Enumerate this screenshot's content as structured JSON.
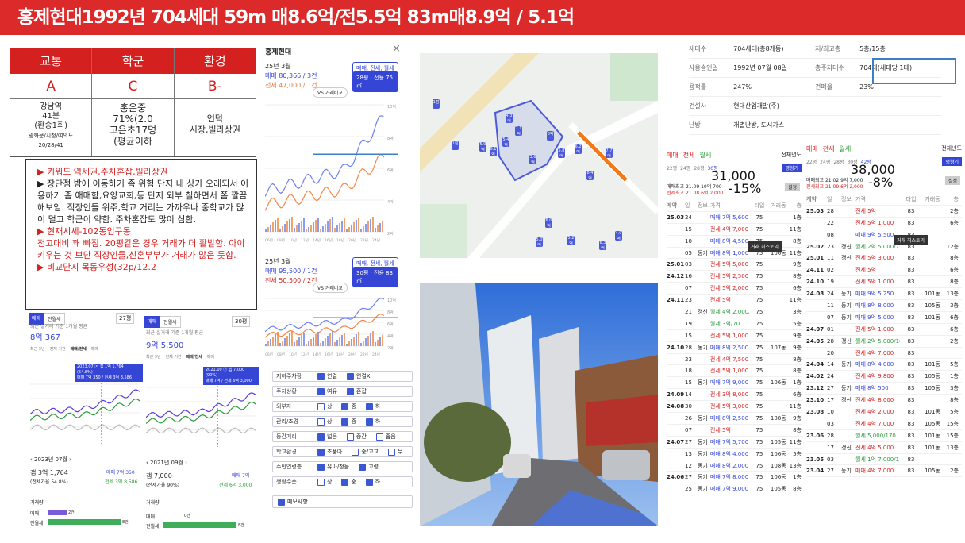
{
  "banner": {
    "title": "홍제현대1992년 704세대 59m 매8.6억/전5.5억 83m매8.9억 / 5.1억"
  },
  "grades": {
    "headers": [
      "교통",
      "학군",
      "환경"
    ],
    "values": [
      "A",
      "C",
      "B-"
    ],
    "details": [
      [
        "강남역",
        "41분",
        "(환승1회)",
        "광화문/시청/여의도",
        "20/28/41"
      ],
      [
        "홍은중",
        "71%(2.0",
        "고은초17명",
        "(평균이하"
      ],
      [
        "언덕",
        "시장,빌라상권"
      ]
    ]
  },
  "notes": {
    "lines": [
      "▶ 키워드 역세권,주차혼잡,빌라상권",
      "▶ 장단점 밤에 이동하기 좀 위험 단지 내 상가 오래되서 이용하기 좀 애매함,요양교회,등 단지 외부 칠하면서 쫌 깔끔해보임. 직장인들 위주,학교 거리는 가까우나 중학교가 많이 멀고 학군이 약함. 주차혼잡도 많이 심함.",
      "▶ 현재시세-102동입구동",
      "전고대비 꽤 빠짐. 20평같은 경우 거래가 더 활발함. 아이키우는 것 보단 직장인들,신혼부부가 거래가 많은 듯함.",
      "▶ 비교단지 목동우성(32p/12.2"
    ]
  },
  "trend_panel": {
    "title": "홍제현대",
    "close": "×",
    "chart1": {
      "month": "25년 3월",
      "sale": "매매 80,366 / 3건",
      "jeonse": "전세 47,000 / 1건",
      "pill1": "매매, 전세, 월세",
      "pill2": "28평 · 전용 75㎡",
      "compare": "VS 거래비교"
    },
    "chart2": {
      "month": "25년 3월",
      "sale": "매매 95,500 / 1건",
      "jeonse": "전세 50,500 / 2건",
      "pill1": "매매, 전세, 월세",
      "pill2": "30평 · 전용 83㎡",
      "compare": "VS 거래비교"
    },
    "xaxis": [
      "06년",
      "08년",
      "10년",
      "12년",
      "14년",
      "16년",
      "18년",
      "20년",
      "22년",
      "24년"
    ],
    "yaxis1": [
      "10억",
      "8억",
      "6억",
      "4억",
      "2억"
    ],
    "yaxis2": [
      "10억",
      "8억",
      "6억",
      "4억",
      "2억"
    ]
  },
  "filter": {
    "rows": [
      {
        "label": "지하주차장",
        "opts": [
          [
            "연결",
            true
          ],
          [
            "연결X",
            true
          ]
        ]
      },
      {
        "label": "주차상황",
        "opts": [
          [
            "여유",
            true
          ],
          [
            "혼잡",
            true
          ]
        ]
      },
      {
        "label": "외부자",
        "opts": [
          [
            "상",
            false
          ],
          [
            "중",
            true
          ],
          [
            "하",
            true
          ]
        ]
      },
      {
        "label": "관리/조경",
        "opts": [
          [
            "상",
            false
          ],
          [
            "중",
            true
          ],
          [
            "하",
            true
          ]
        ]
      },
      {
        "label": "동간거리",
        "opts": [
          [
            "넓음",
            true
          ],
          [
            "중간",
            false
          ],
          [
            "좁음",
            false
          ]
        ]
      },
      {
        "label": "학교환경",
        "opts": [
          [
            "초품아",
            true
          ],
          [
            "중/고교",
            false
          ],
          [
            "무",
            false
          ]
        ]
      },
      {
        "label": "주민연령층",
        "opts": [
          [
            "유아/청음",
            true
          ],
          [
            "고령",
            true
          ]
        ]
      },
      {
        "label": "생활수준",
        "opts": [
          [
            "상",
            false
          ],
          [
            "중",
            true
          ],
          [
            "하",
            true
          ]
        ]
      }
    ],
    "memo": "메모사항"
  },
  "price_left": {
    "tab1": "매매",
    "tab2": "전월세",
    "select": "27평",
    "caption": "최근 실거래 기준 1개월 평균",
    "price": "8억 367",
    "tabs": [
      "최근 3년",
      "전체 기간",
      "매매/전세",
      "매매"
    ],
    "tip1": "2023.07 ⓔ 갭 1억 1,764 (54.8%)",
    "tip2": "매매 7억 350 / 전세 3억 8,586",
    "date": "2023년 07월",
    "gap": "갭 3억 1,764",
    "ratio": "(전세가율 54.8%)",
    "sv": "매매 7억 350",
    "jv": "전세 3억 8,586",
    "vol_title": "거래량",
    "vol1": "매매",
    "vol2": "전월세",
    "vol1n": "2건",
    "vol2n": "8건"
  },
  "price_right": {
    "tab1": "매매",
    "tab2": "전월세",
    "select": "30평",
    "caption": "최근 실거래 기준 1개월 평균",
    "price": "9억 5,500",
    "tabs": [
      "최근 3년",
      "전체 기간",
      "매매/전세",
      "매매"
    ],
    "tip1": "2021.09 ⓔ 갭 7,000 (90%)",
    "tip2": "매매 7억 / 전세 6억 3,000",
    "date": "2021년 09월",
    "gap": "갭 7,000",
    "ratio": "(전세가율 90%)",
    "sv": "매매 7억",
    "jv": "전세 6억 3,000",
    "vol_title": "거래량",
    "vol1": "매매",
    "vol2": "전월세",
    "vol1n": "0건",
    "vol2n": "8건"
  },
  "summary": {
    "rows": [
      [
        "세대수",
        "704세대(총8개동)",
        "저/최고층",
        "5층/15층"
      ],
      [
        "사용승인일",
        "1992년 07월 08일",
        "총주차대수",
        "704대(세대당 1대)"
      ],
      [
        "용적률",
        "247%",
        "건폐율",
        "23%"
      ],
      [
        "건설사",
        "현대산업개발(주)",
        "",
        ""
      ],
      [
        "난방",
        "개별난방, 도시가스",
        "",
        ""
      ]
    ]
  },
  "table_left": {
    "tabs": [
      "매매",
      "전세",
      "월세"
    ],
    "year": "전체년도",
    "cols": [
      "22평",
      "24평",
      "28평",
      "30평"
    ],
    "btn": "평형기",
    "btn2": "설정",
    "overlay1": "31,000",
    "overlay2": "-15%",
    "line1": "매매최고 21.09 10억 700",
    "line2": "전세최고 21.08 6억 2,000",
    "tooltip": "거래 히스토리",
    "head": [
      "계약",
      "일",
      "정보",
      "가격",
      "타입",
      "거래동",
      "층"
    ],
    "rows": [
      [
        "25.03",
        "24",
        "",
        "매매 7억 5,600",
        "75",
        "",
        "1층",
        "b"
      ],
      [
        "",
        "15",
        "",
        "전세 4억 7,000",
        "75",
        "",
        "11층",
        "r"
      ],
      [
        "",
        "10",
        "",
        "매매 8억 4,500",
        "75",
        "",
        "8층",
        "b"
      ],
      [
        "",
        "05",
        "동기",
        "매매 8억 1,000",
        "75",
        "106동",
        "11층",
        "b"
      ],
      [
        "25.01",
        "03",
        "",
        "전세 5억 5,000",
        "75",
        "",
        "9층",
        "r"
      ],
      [
        "24.12",
        "16",
        "",
        "전세 5억 2,500",
        "75",
        "",
        "8층",
        "r"
      ],
      [
        "",
        "07",
        "",
        "전세 5억 2,000",
        "75",
        "",
        "6층",
        "r"
      ],
      [
        "24.11",
        "23",
        "",
        "전세 5억",
        "75",
        "",
        "11층",
        "r"
      ],
      [
        "",
        "21",
        "갱신",
        "월세 4억 2,000/48",
        "75",
        "",
        "3층",
        "g"
      ],
      [
        "",
        "19",
        "",
        "월세 3억/70",
        "75",
        "",
        "5층",
        "g"
      ],
      [
        "",
        "15",
        "",
        "전세 5억 1,000",
        "75",
        "",
        "9층",
        "r"
      ],
      [
        "24.10",
        "28",
        "동기",
        "매매 8억 2,500",
        "75",
        "107동",
        "9층",
        "b"
      ],
      [
        "",
        "23",
        "",
        "전세 4억 7,500",
        "75",
        "",
        "8층",
        "r"
      ],
      [
        "",
        "18",
        "",
        "전세 5억 1,000",
        "75",
        "",
        "8층",
        "r"
      ],
      [
        "",
        "15",
        "동기",
        "매매 7억 9,000",
        "75",
        "106동",
        "1층",
        "b"
      ],
      [
        "24.09",
        "14",
        "",
        "전세 3억 8,000",
        "75",
        "",
        "6층",
        "r"
      ],
      [
        "24.08",
        "30",
        "",
        "전세 5억 3,000",
        "75",
        "",
        "11층",
        "r"
      ],
      [
        "",
        "26",
        "동기",
        "매매 8억 2,500",
        "75",
        "108동",
        "9층",
        "b"
      ],
      [
        "",
        "07",
        "",
        "전세 5억",
        "75",
        "",
        "8층",
        "r"
      ],
      [
        "24.07",
        "27",
        "동기",
        "매매 7억 5,700",
        "75",
        "105동",
        "11층",
        "b"
      ],
      [
        "",
        "13",
        "동기",
        "매매 8억 4,000",
        "75",
        "106동",
        "5층",
        "b"
      ],
      [
        "",
        "12",
        "동기",
        "매매 8억 2,000",
        "75",
        "108동",
        "13층",
        "b"
      ],
      [
        "24.06",
        "27",
        "동기",
        "매매 7억 8,000",
        "75",
        "106동",
        "1층",
        "b"
      ],
      [
        "",
        "25",
        "동기",
        "매매 7억 9,000",
        "75",
        "105동",
        "8층",
        "b"
      ]
    ]
  },
  "table_right": {
    "tabs": [
      "매매",
      "전세",
      "월세"
    ],
    "year": "전체년도",
    "cols": [
      "22평",
      "24평",
      "28평",
      "30평",
      "42평"
    ],
    "btn": "평형기",
    "btn2": "설정",
    "overlay1": "38,000",
    "overlay2": "-8%",
    "line1": "매매최고 21.02 9억 7,000",
    "line2": "전세최고 21.09 6억 2,000",
    "tooltip": "거래 히스토리",
    "head": [
      "계약",
      "일",
      "정보",
      "가격",
      "타입",
      "거래동",
      "층"
    ],
    "rows": [
      [
        "25.03",
        "28",
        "",
        "전세 5억",
        "83",
        "",
        "2층",
        "r"
      ],
      [
        "",
        "22",
        "",
        "전세 5억 1,000",
        "83",
        "",
        "6층",
        "r"
      ],
      [
        "",
        "08",
        "",
        "매매 9억 5,500",
        "83",
        "",
        "",
        "b"
      ],
      [
        "25.02",
        "23",
        "갱신",
        "월세 2억 5,000/75",
        "83",
        "",
        "12층",
        "g"
      ],
      [
        "25.01",
        "11",
        "갱신",
        "전세 5억 3,000",
        "83",
        "",
        "8층",
        "r"
      ],
      [
        "24.11",
        "02",
        "",
        "전세 5억",
        "83",
        "",
        "6층",
        "r"
      ],
      [
        "24.10",
        "19",
        "",
        "전세 5억 1,000",
        "83",
        "",
        "8층",
        "r"
      ],
      [
        "24.08",
        "24",
        "동기",
        "매매 9억 5,250",
        "83",
        "101동",
        "13층",
        "b"
      ],
      [
        "",
        "11",
        "동기",
        "매매 8억 8,000",
        "83",
        "105동",
        "3층",
        "b"
      ],
      [
        "",
        "07",
        "동기",
        "매매 9억 5,000",
        "83",
        "101동",
        "6층",
        "b"
      ],
      [
        "24.07",
        "01",
        "",
        "전세 5억 1,000",
        "83",
        "",
        "6층",
        "r"
      ],
      [
        "24.05",
        "28",
        "갱신",
        "월세 2억 5,000/105",
        "83",
        "",
        "2층",
        "g"
      ],
      [
        "",
        "20",
        "",
        "전세 4억 7,000",
        "83",
        "",
        "",
        "r"
      ],
      [
        "24.04",
        "14",
        "동기",
        "매매 8억 4,000",
        "83",
        "101동",
        "5층",
        "b"
      ],
      [
        "24.02",
        "24",
        "",
        "전세 4억 9,800",
        "83",
        "105동",
        "1층",
        "r"
      ],
      [
        "23.12",
        "27",
        "동기",
        "매매 8억 500",
        "83",
        "105동",
        "3층",
        "b"
      ],
      [
        "23.10",
        "17",
        "갱신",
        "전세 4억 8,000",
        "83",
        "",
        "8층",
        "r"
      ],
      [
        "23.08",
        "10",
        "",
        "전세 4억 2,000",
        "83",
        "101동",
        "5층",
        "r"
      ],
      [
        "",
        "03",
        "",
        "전세 4억 7,000",
        "83",
        "105동",
        "15층",
        "r"
      ],
      [
        "23.06",
        "28",
        "",
        "월세 5,000/170",
        "83",
        "101동",
        "15층",
        "g"
      ],
      [
        "",
        "17",
        "갱신",
        "전세 4억 5,000",
        "83",
        "101동",
        "13층",
        "r"
      ],
      [
        "23.05",
        "03",
        "",
        "월세 1억 7,000/110",
        "83",
        "",
        "",
        "g"
      ],
      [
        "23.04",
        "27",
        "동기",
        "매매 4억 7,000",
        "83",
        "105동",
        "2층",
        "r"
      ]
    ]
  },
  "map": {
    "labels": [
      "1점",
      "1점",
      "5.9억",
      "6.1억",
      "5.4억",
      "7.1억",
      "3.6억",
      "8억",
      "5.8억",
      "4.3억",
      "6.2억",
      "8.4억",
      "7.7억",
      "4.9억",
      "6.0억",
      "5.0억",
      "5.2억",
      "6.3억"
    ]
  }
}
